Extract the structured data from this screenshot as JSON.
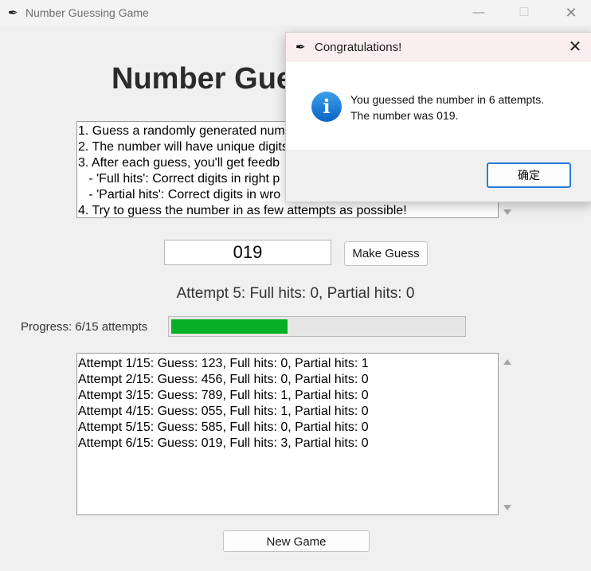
{
  "window": {
    "title": "Number Guessing Game",
    "minimize_glyph": "—",
    "maximize_glyph": "☐",
    "close_glyph": "✕"
  },
  "heading": "Number Gue",
  "instructions": [
    "1. Guess a randomly generated num",
    "2. The number will have unique digits",
    "3. After each guess, you'll get feedb",
    "   - 'Full hits': Correct digits in right p",
    "   - 'Partial hits': Correct digits in wro",
    "4. Try to guess the number in as few attempts as possible!"
  ],
  "guess": {
    "value": "019",
    "button_label": "Make Guess"
  },
  "result_text": "Attempt 5: Full hits: 0, Partial hits: 0",
  "progress": {
    "label": "Progress: 6/15 attempts",
    "current": 6,
    "max": 15,
    "fill_color": "#06b025"
  },
  "history": [
    "Attempt 1/15: Guess: 123, Full hits: 0, Partial hits: 1",
    "Attempt 2/15: Guess: 456, Full hits: 0, Partial hits: 0",
    "Attempt 3/15: Guess: 789, Full hits: 1, Partial hits: 0",
    "Attempt 4/15: Guess: 055, Full hits: 1, Partial hits: 0",
    "Attempt 5/15: Guess: 585, Full hits: 0, Partial hits: 0",
    "Attempt 6/15: Guess: 019, Full hits: 3, Partial hits: 0"
  ],
  "new_game_label": "New Game",
  "dialog": {
    "title": "Congratulations!",
    "icon": "info-icon",
    "icon_glyph": "i",
    "close_glyph": "✕",
    "message_line1": "You guessed the number in 6 attempts.",
    "message_line2": "The number was 019.",
    "ok_label": "确定"
  },
  "icons": {
    "app_icon": "feather-icon",
    "app_glyph": "✒"
  }
}
